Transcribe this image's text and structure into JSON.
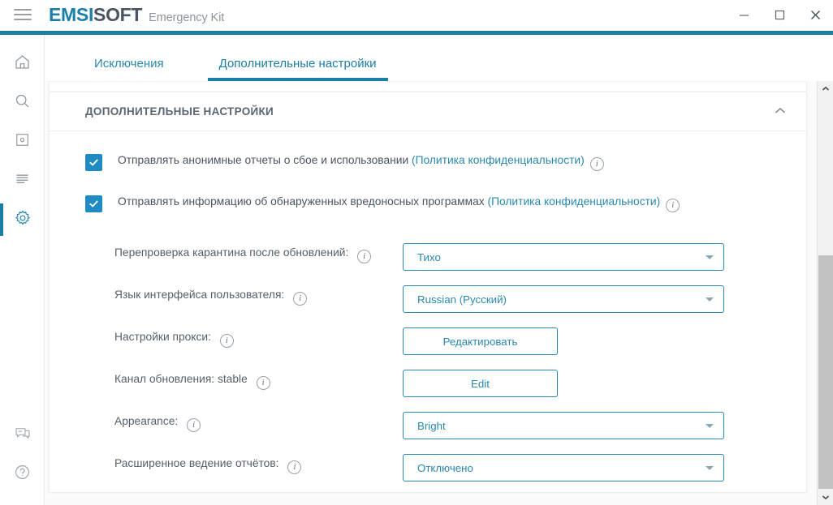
{
  "window": {
    "brand_primary": "EMSI",
    "brand_secondary": "SOFT",
    "brand_subtitle": "Emergency Kit",
    "menu_icon": "hamburger-icon",
    "minimize_label": "—",
    "maximize_label": "□",
    "close_label": "✕",
    "accent_color": "#1b7ea6"
  },
  "sidebar": {
    "items": [
      {
        "icon": "home-icon",
        "name": "home",
        "active": false
      },
      {
        "icon": "search-icon",
        "name": "scan",
        "active": false
      },
      {
        "icon": "quarantine-icon",
        "name": "quarantine",
        "active": false
      },
      {
        "icon": "logs-icon",
        "name": "logs",
        "active": false
      },
      {
        "icon": "gear-icon",
        "name": "settings",
        "active": true
      }
    ],
    "bottom_items": [
      {
        "icon": "chat-icon",
        "name": "support"
      },
      {
        "icon": "help-icon",
        "name": "help"
      }
    ]
  },
  "tabs": [
    {
      "label": "Исключения",
      "active": false
    },
    {
      "label": "Дополнительные настройки",
      "active": true
    }
  ],
  "card": {
    "title": "ДОПОЛНИТЕЛЬНЫЕ НАСТРОЙКИ",
    "collapse_icon": "chevron-up-icon"
  },
  "checkboxes": [
    {
      "checked": true,
      "text": "Отправлять анонимные отчеты о сбое и использовании ",
      "link": "(Политика конфиденциальности)",
      "info": "i"
    },
    {
      "checked": true,
      "text": "Отправлять информацию об обнаруженных вредоносных программах ",
      "link": "(Политика конфиденциальности)",
      "info": "i"
    }
  ],
  "settings": {
    "rescan_quarantine": {
      "label": "Перепроверка карантина после обновлений:",
      "info": "i",
      "control": "select",
      "value": "Тихо"
    },
    "ui_language": {
      "label": "Язык интерфейса пользователя:",
      "info": "i",
      "control": "select",
      "value": "Russian (Русский)"
    },
    "proxy_settings": {
      "label": "Настройки прокси:",
      "info": "i",
      "control": "button",
      "value": "Редактировать"
    },
    "update_channel": {
      "label": "Канал обновления: stable",
      "info": "i",
      "control": "button",
      "value": "Edit"
    },
    "appearance": {
      "label": "Appearance:",
      "info": "i",
      "control": "select",
      "value": "Bright"
    },
    "extended_logging": {
      "label": "Расширенное ведение отчётов:",
      "info": "i",
      "control": "select",
      "value": "Отключено"
    }
  },
  "scrollbar": {
    "up_icon": "chevron-up-icon",
    "down_icon": "chevron-down-icon"
  }
}
